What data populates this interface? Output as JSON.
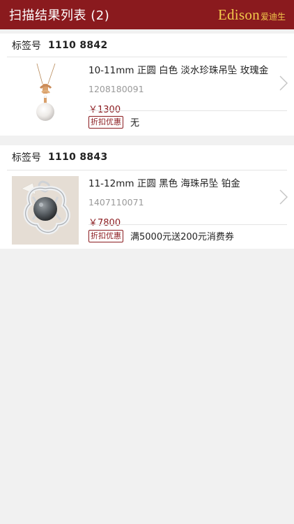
{
  "header": {
    "title": "扫描结果列表 (2)",
    "brand_latin": "Edison",
    "brand_cjk": "爱迪生"
  },
  "colors": {
    "brand": "#8a1a1e",
    "logo": "#f2c94c",
    "background": "#f1f1f1"
  },
  "items": [
    {
      "tag_label": "标签号",
      "tag_number": "1110 8842",
      "title": "10-11mm 正圆 白色 淡水珍珠吊坠 玫瑰金",
      "code": "1208180091",
      "price": "￥1300",
      "promo_badge": "折扣优惠",
      "promo_text": "无",
      "image_icon": "pearl-pendant-rose-gold"
    },
    {
      "tag_label": "标签号",
      "tag_number": "1110 8843",
      "title": "11-12mm 正圆 黑色 海珠吊坠 铂金",
      "code": "1407110071",
      "price": "￥7800",
      "promo_badge": "折扣优惠",
      "promo_text": "满5000元送200元消费券",
      "image_icon": "black-pearl-flower-pendant"
    }
  ]
}
